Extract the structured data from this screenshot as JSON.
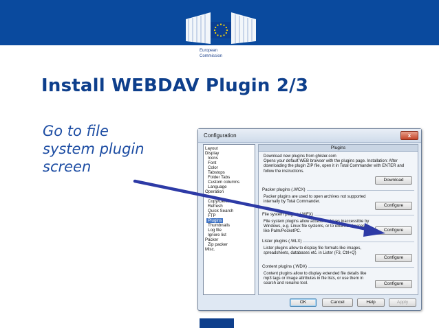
{
  "branding": {
    "org_line1": "European",
    "org_line2": "Commission",
    "band_color": "#0a4a9e",
    "title_color": "#0e3f8c"
  },
  "slide": {
    "title": "Install WEBDAV Plugin 2/3",
    "bullet_line1": "Go to file",
    "bullet_line2": "system plugin",
    "bullet_line3": "screen"
  },
  "dialog": {
    "title": "Configuration",
    "close_label": "x",
    "tree": [
      "Layout",
      "Display",
      "Icons",
      "Font",
      "Color",
      "Tabstops",
      "Folder Tabs",
      "Custom columns",
      "Language",
      "Operation",
      "",
      "Copy/Delete",
      "Refresh",
      "Quick Search",
      "FTP",
      "Plugins",
      "Thumbnails",
      "Log file",
      "Ignore list",
      "Packer",
      "Zip packer",
      "Misc."
    ],
    "selected_tree_item": "Plugins",
    "panel_header": "Plugins",
    "download": {
      "line1": "Download new plugins from ghisler.com",
      "line2": "Opens your default WEB browser with the plugins page. Installation: After",
      "line3": "downloading the plugin ZIP file, open it in Total Commander with ENTER and",
      "line4": "follow the instructions.",
      "button": "Download"
    },
    "packer": {
      "title": "Packer plugins (.WCX)",
      "line1": "Packer plugins are used to open archives not supported",
      "line2": "internally by Total Commander.",
      "button": "Configure"
    },
    "filesystem": {
      "title": "File system plugins (.WFX)",
      "line1": "File system plugins allow access to drives inaccessible by",
      "line2": "Windows, e.g. Linux file systems, or to external devices",
      "line3": "like Palm/PocketPC.",
      "button": "Configure"
    },
    "lister": {
      "title": "Lister plugins (.WLX)",
      "line1": "Lister plugins allow to display file formats like images,",
      "line2": "spreadsheets, databases etc. in Lister (F3, Ctrl+Q)",
      "button": "Configure"
    },
    "content": {
      "title": "Content plugins (.WDX)",
      "line1": "Content plugins allow to display extended file details like",
      "line2": "mp3 tags or image attributes in file lists, or use them in",
      "line3": "search and rename tool.",
      "button": "Configure"
    },
    "footer": {
      "ok": "OK",
      "cancel": "Cancel",
      "help": "Help",
      "apply": "Apply"
    }
  },
  "icons": {
    "logo": "european-commission-logo-icon",
    "close": "close-icon",
    "arrow": "pointer-arrow-icon"
  }
}
